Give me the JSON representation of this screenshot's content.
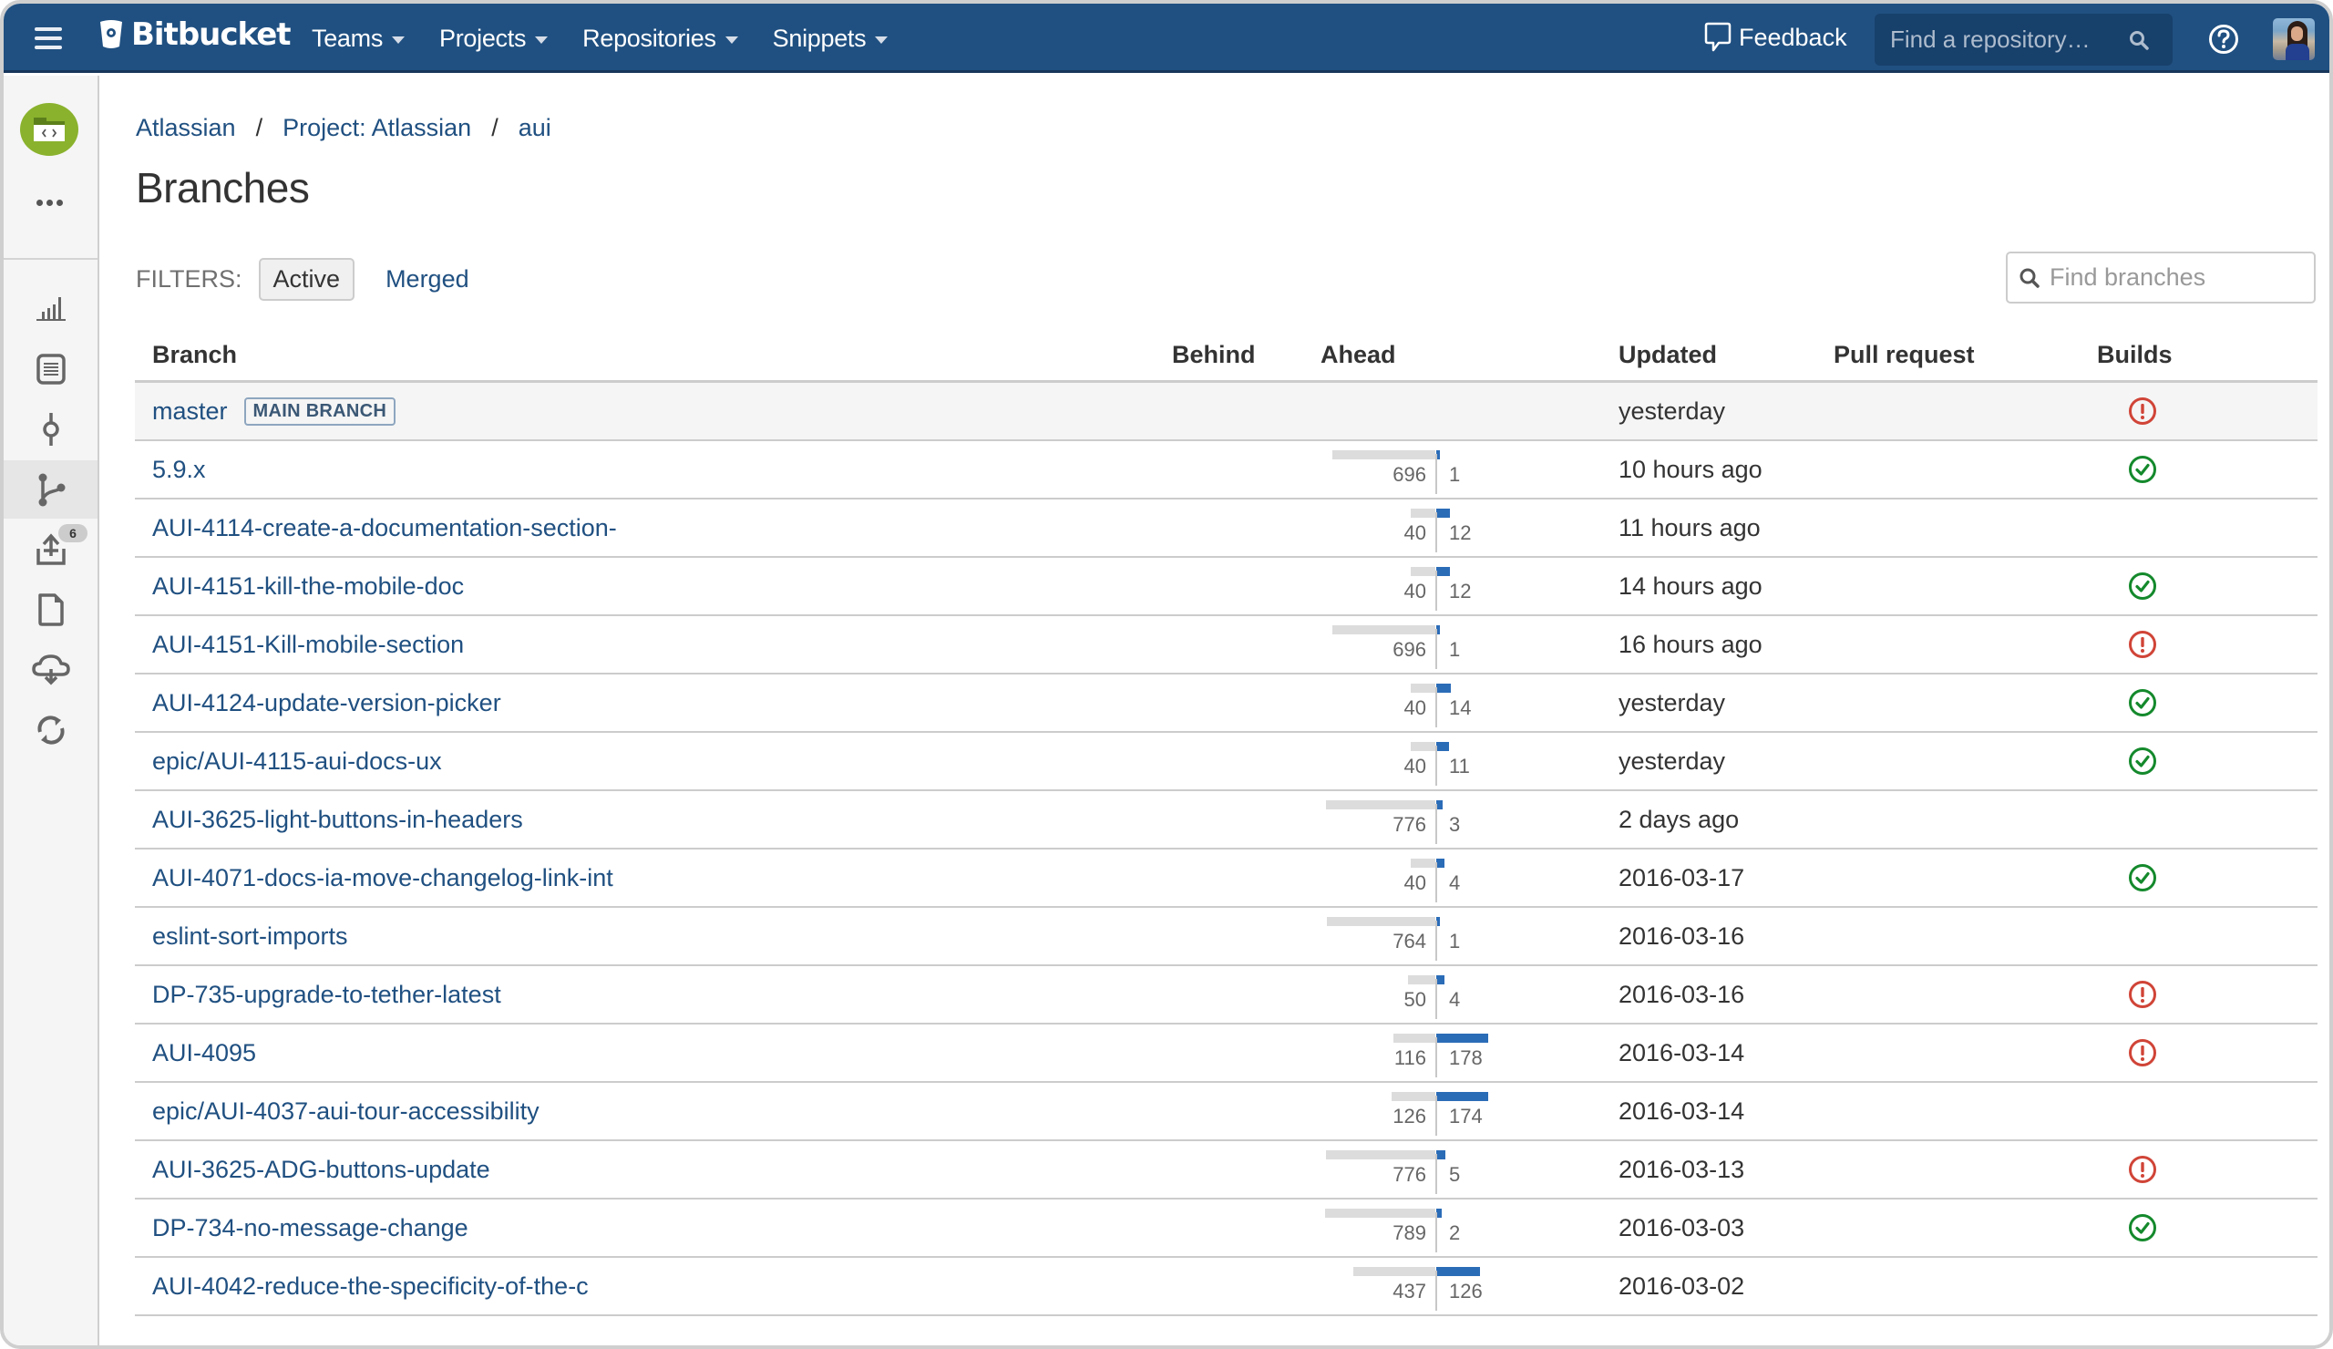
{
  "header": {
    "brand": "Bitbucket",
    "nav": [
      {
        "label": "Teams"
      },
      {
        "label": "Projects"
      },
      {
        "label": "Repositories"
      },
      {
        "label": "Snippets"
      }
    ],
    "feedback_label": "Feedback",
    "repo_search_placeholder": "Find a repository…",
    "colors": {
      "bar": "#205081"
    }
  },
  "sidebar": {
    "items": [
      {
        "name": "overview",
        "icon": "bar-chart-icon"
      },
      {
        "name": "source",
        "icon": "document-list-icon"
      },
      {
        "name": "commits",
        "icon": "commit-icon"
      },
      {
        "name": "branches",
        "icon": "branch-icon",
        "active": true
      },
      {
        "name": "pull-requests",
        "icon": "pull-request-icon",
        "badge": "6"
      },
      {
        "name": "files",
        "icon": "file-icon"
      },
      {
        "name": "downloads",
        "icon": "cloud-download-icon"
      },
      {
        "name": "sync",
        "icon": "sync-icon"
      }
    ]
  },
  "breadcrumb": [
    {
      "label": "Atlassian"
    },
    {
      "label": "Project: Atlassian"
    },
    {
      "label": "aui"
    }
  ],
  "breadcrumb_separator": "/",
  "page_title": "Branches",
  "filters": {
    "label": "FILTERS:",
    "active_label": "Active",
    "merged_label": "Merged"
  },
  "branch_search_placeholder": "Find branches",
  "table": {
    "columns": {
      "branch": "Branch",
      "behind": "Behind",
      "ahead": "Ahead",
      "updated": "Updated",
      "pull_request": "Pull request",
      "builds": "Builds"
    },
    "main_branch_lozenge": "MAIN BRANCH",
    "rows": [
      {
        "name": "master",
        "main": true,
        "behind": null,
        "ahead": null,
        "updated": "yesterday",
        "build": "failed"
      },
      {
        "name": "5.9.x",
        "behind": 696,
        "ahead": 1,
        "updated": "10 hours ago",
        "build": "success"
      },
      {
        "name": "AUI-4114-create-a-documentation-section-",
        "behind": 40,
        "ahead": 12,
        "updated": "11 hours ago",
        "build": null
      },
      {
        "name": "AUI-4151-kill-the-mobile-doc",
        "behind": 40,
        "ahead": 12,
        "updated": "14 hours ago",
        "build": "success"
      },
      {
        "name": "AUI-4151-Kill-mobile-section",
        "behind": 696,
        "ahead": 1,
        "updated": "16 hours ago",
        "build": "failed"
      },
      {
        "name": "AUI-4124-update-version-picker",
        "behind": 40,
        "ahead": 14,
        "updated": "yesterday",
        "build": "success"
      },
      {
        "name": "epic/AUI-4115-aui-docs-ux",
        "behind": 40,
        "ahead": 11,
        "updated": "yesterday",
        "build": "success"
      },
      {
        "name": "AUI-3625-light-buttons-in-headers",
        "behind": 776,
        "ahead": 3,
        "updated": "2 days ago",
        "build": null
      },
      {
        "name": "AUI-4071-docs-ia-move-changelog-link-int",
        "behind": 40,
        "ahead": 4,
        "updated": "2016-03-17",
        "build": "success"
      },
      {
        "name": "eslint-sort-imports",
        "behind": 764,
        "ahead": 1,
        "updated": "2016-03-16",
        "build": null
      },
      {
        "name": "DP-735-upgrade-to-tether-latest",
        "behind": 50,
        "ahead": 4,
        "updated": "2016-03-16",
        "build": "failed"
      },
      {
        "name": "AUI-4095",
        "behind": 116,
        "ahead": 178,
        "updated": "2016-03-14",
        "build": "failed"
      },
      {
        "name": "epic/AUI-4037-aui-tour-accessibility",
        "behind": 126,
        "ahead": 174,
        "updated": "2016-03-14",
        "build": null
      },
      {
        "name": "AUI-3625-ADG-buttons-update",
        "behind": 776,
        "ahead": 5,
        "updated": "2016-03-13",
        "build": "failed"
      },
      {
        "name": "DP-734-no-message-change",
        "behind": 789,
        "ahead": 2,
        "updated": "2016-03-03",
        "build": "success"
      },
      {
        "name": "AUI-4042-reduce-the-specificity-of-the-c",
        "behind": 437,
        "ahead": 126,
        "updated": "2016-03-02",
        "build": null
      }
    ]
  },
  "colors": {
    "link": "#205081",
    "ahead_bar": "#2b6cb7",
    "behind_bar": "#dcdcdc",
    "build_success": "#14892c",
    "build_failed": "#d04437",
    "project_avatar": "#8ab22d"
  }
}
